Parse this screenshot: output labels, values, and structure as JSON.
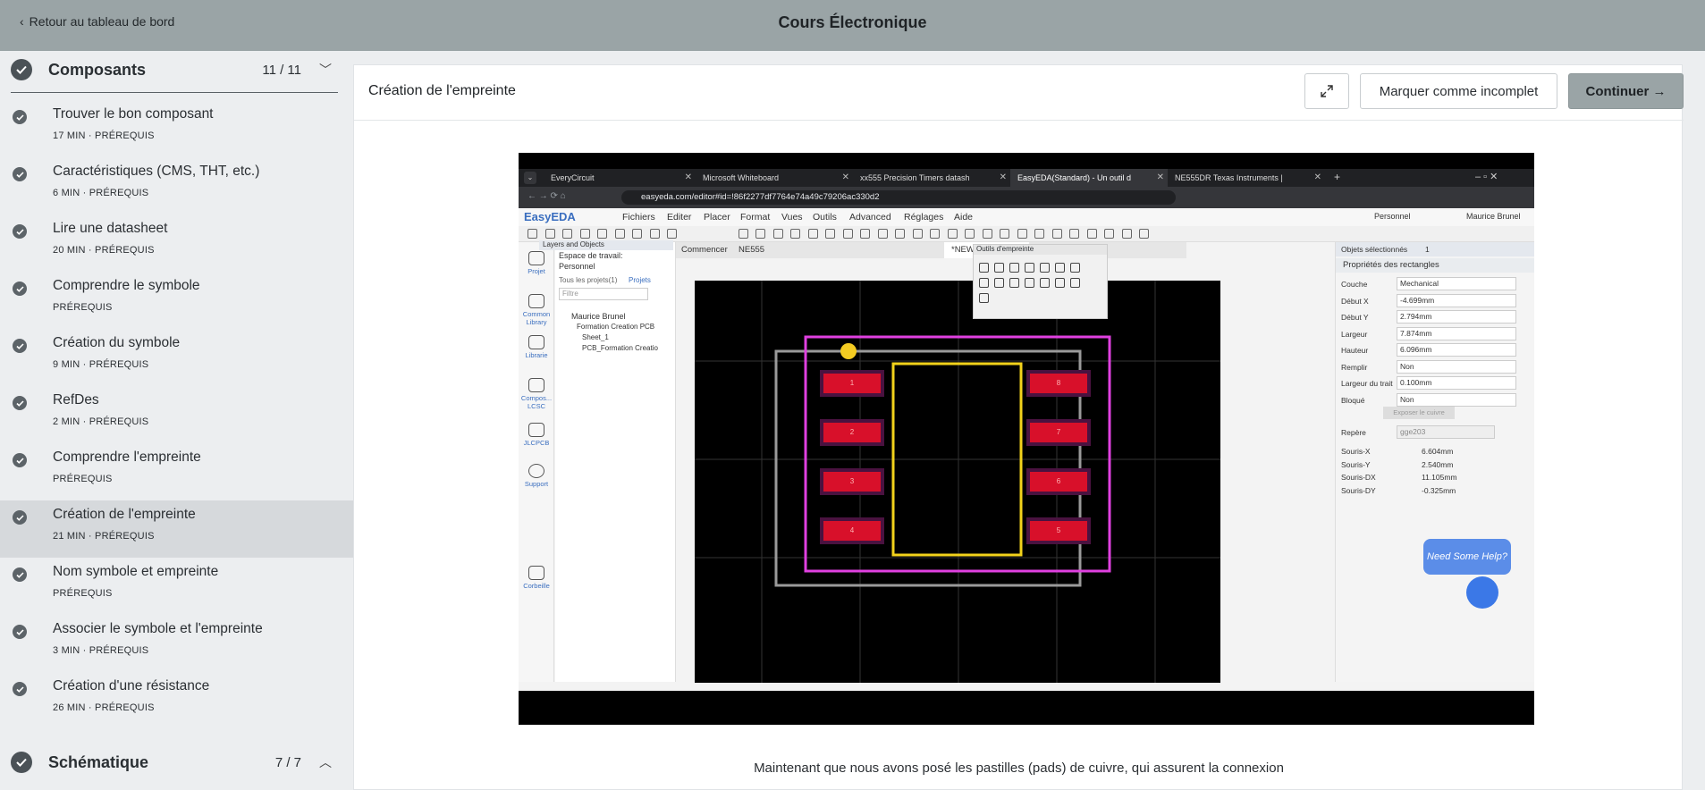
{
  "topbar": {
    "back_label": "Retour au tableau de bord",
    "course_title": "Cours Électronique"
  },
  "sidebar": {
    "section1": {
      "title": "Composants",
      "count": "11 / 11"
    },
    "items": [
      {
        "title": "Trouver le bon composant",
        "meta": "17 MIN ·  PRÉREQUIS"
      },
      {
        "title": "Caractéristiques (CMS, THT, etc.)",
        "meta": "6 MIN ·  PRÉREQUIS"
      },
      {
        "title": "Lire une datasheet",
        "meta": "20 MIN ·  PRÉREQUIS"
      },
      {
        "title": "Comprendre le symbole",
        "meta": "PRÉREQUIS"
      },
      {
        "title": "Création du symbole",
        "meta": "9 MIN ·  PRÉREQUIS"
      },
      {
        "title": "RefDes",
        "meta": "2 MIN ·  PRÉREQUIS"
      },
      {
        "title": "Comprendre l'empreinte",
        "meta": "PRÉREQUIS"
      },
      {
        "title": "Création de l'empreinte",
        "meta": "21 MIN ·  PRÉREQUIS"
      },
      {
        "title": "Nom symbole et empreinte",
        "meta": "PRÉREQUIS"
      },
      {
        "title": "Associer le symbole et l'empreinte",
        "meta": "3 MIN ·  PRÉREQUIS"
      },
      {
        "title": "Création d'une résistance",
        "meta": "26 MIN ·  PRÉREQUIS"
      }
    ],
    "section2": {
      "title": "Schématique",
      "count": "7 / 7"
    }
  },
  "main": {
    "lesson_title": "Création de l'empreinte",
    "mark_incomplete": "Marquer comme incomplet",
    "continue": "Continuer →",
    "caption": "Maintenant que nous avons posé les pastilles (pads) de cuivre, qui assurent la connexion"
  },
  "video": {
    "tabs": [
      "EveryCircuit",
      "Microsoft Whiteboard",
      "xx555 Precision Timers datash",
      "EasyEDA(Standard) - Un outil d",
      "NE555DR Texas Instruments |"
    ],
    "url": "easyeda.com/editor#id=!86f2277df7764e74a49c79206ac330d2",
    "brand": "EasyEDA",
    "menus": [
      "Fichiers",
      "Editer",
      "Placer",
      "Format",
      "Vues",
      "Outils",
      "Advanced",
      "Réglages",
      "Aide"
    ],
    "user": "Maurice Brunel",
    "personnel": "Personnel",
    "nav": [
      "Projet",
      "Common Library",
      "Librarie",
      "Compos... LCSC",
      "JLCPCB",
      "Support",
      "Corbeille"
    ],
    "panel": {
      "header": "Layers and Objects",
      "workspace": "Espace de travail:",
      "personnel": "Personnel",
      "all_projects": "Tous les projets(1)",
      "projects_link": "Projets",
      "filter": "Filtre",
      "tree": [
        "Maurice Brunel",
        "Formation Creation PCB",
        "Sheet_1",
        "PCB_Formation Creatio"
      ]
    },
    "doc_tabs": [
      "Commencer",
      "NE555",
      "*NEW_FOOTPR..."
    ],
    "tools_title": "Outils d'empreinte",
    "props": {
      "selected_label": "Objets sélectionnés",
      "selected_value": "1",
      "section": "Propriétés des rectangles",
      "rows": [
        {
          "label": "Couche",
          "value": "Mechanical"
        },
        {
          "label": "Début X",
          "value": "-4.699mm"
        },
        {
          "label": "Début Y",
          "value": "2.794mm"
        },
        {
          "label": "Largeur",
          "value": "7.874mm"
        },
        {
          "label": "Hauteur",
          "value": "6.096mm"
        },
        {
          "label": "Remplir",
          "value": "Non"
        },
        {
          "label": "Largeur du trait",
          "value": "0.100mm"
        },
        {
          "label": "Bloqué",
          "value": "Non"
        }
      ],
      "expose_btn": "Exposer le cuivre",
      "repere_label": "Repère",
      "repere_value": "gge203",
      "mouse": [
        {
          "label": "Souris-X",
          "value": "6.604mm"
        },
        {
          "label": "Souris-Y",
          "value": "2.540mm"
        },
        {
          "label": "Souris-DX",
          "value": "11.105mm"
        },
        {
          "label": "Souris-DY",
          "value": "-0.325mm"
        }
      ]
    },
    "pads_left": [
      "1",
      "2",
      "3",
      "4"
    ],
    "pads_right": [
      "8",
      "7",
      "6",
      "5"
    ],
    "help": "Need Some Help?"
  }
}
